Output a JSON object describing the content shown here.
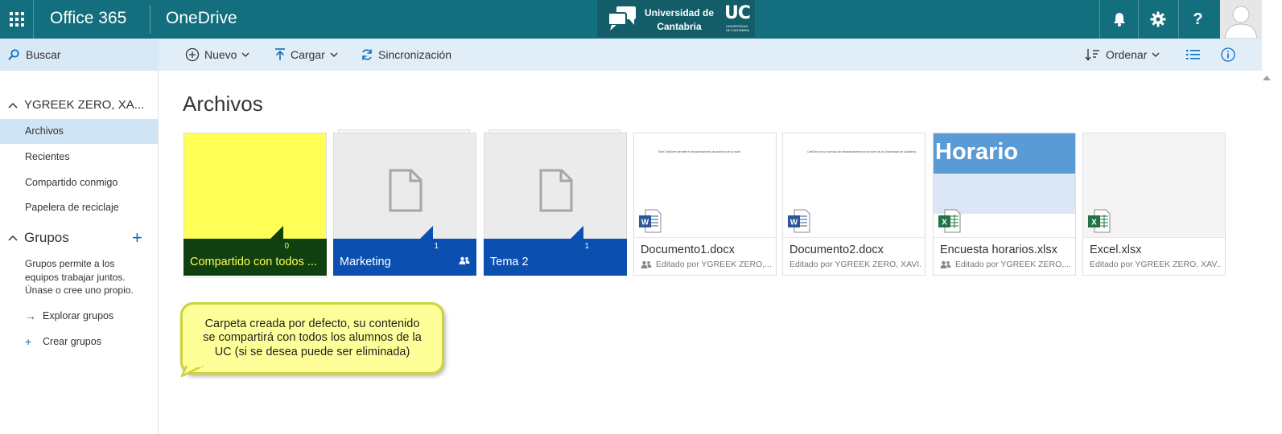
{
  "suite_bar": {
    "brand": "Office 365",
    "app_name": "OneDrive",
    "university": {
      "line1": "Universidad de",
      "line2": "Cantabria",
      "mark": "UC",
      "mark_sub": "UNIVERSIDAD DE CANTABRIA"
    },
    "icons": [
      "app-launcher-icon",
      "bell-icon",
      "gear-icon",
      "help-icon",
      "avatar"
    ]
  },
  "command_bar": {
    "search_label": "Buscar",
    "new_label": "Nuevo",
    "upload_label": "Cargar",
    "sync_label": "Sincronización",
    "sort_label": "Ordenar"
  },
  "left_nav": {
    "user_header": "YGREEK ZERO, XA...",
    "items": [
      {
        "label": "Archivos",
        "active": true
      },
      {
        "label": "Recientes",
        "active": false
      },
      {
        "label": "Compartido conmigo",
        "active": false
      },
      {
        "label": "Papelera de reciclaje",
        "active": false
      }
    ],
    "groups_header": "Grupos",
    "groups_description": "Grupos permite a los equipos trabajar juntos. Únase o cree uno propio.",
    "explore_groups": "Explorar grupos",
    "create_groups": "Crear grupos"
  },
  "main": {
    "title": "Archivos",
    "folders": [
      {
        "name": "Compartido con todos ...",
        "count": "0",
        "shared": false,
        "color": "#ffff55"
      },
      {
        "name": "Marketing",
        "count": "1",
        "shared": true,
        "color": "#0b4fb1"
      },
      {
        "name": "Tema 2",
        "count": "1",
        "shared": false,
        "color": "#0b4fb1"
      }
    ],
    "files": [
      {
        "name": "Documento1.docx",
        "meta": "Editado por YGREEK ZERO,...",
        "type": "word",
        "preview": "Este OneDrive permite el almacenamiento de archivos en la nube."
      },
      {
        "name": "Documento2.docx",
        "meta": "Editado por YGREEK ZERO, XAVI...",
        "type": "word",
        "preview": "OneDrive es un servicio de almacenamiento en la nube de la Universidad de Cantabria."
      },
      {
        "name": "Encuesta horarios.xlsx",
        "meta": "Editado por YGREEK ZERO,...",
        "type": "excel",
        "preview": "Horario"
      },
      {
        "name": "Excel.xlsx",
        "meta": "Editado por YGREEK ZERO, XAV...",
        "type": "excel",
        "preview": ""
      }
    ]
  },
  "callout": {
    "text": "Carpeta creada por defecto, su contenido se compartirá con todos los alumnos de la UC (si se desea puede ser eliminada)"
  },
  "colors": {
    "suite_bar": "#136f7d",
    "command_bar": "#e1eef8",
    "folder_blue": "#0b4fb1",
    "folder_yellow": "#ffff55",
    "folder_dark_green": "#10400f",
    "callout_fill": "#ffff99"
  }
}
